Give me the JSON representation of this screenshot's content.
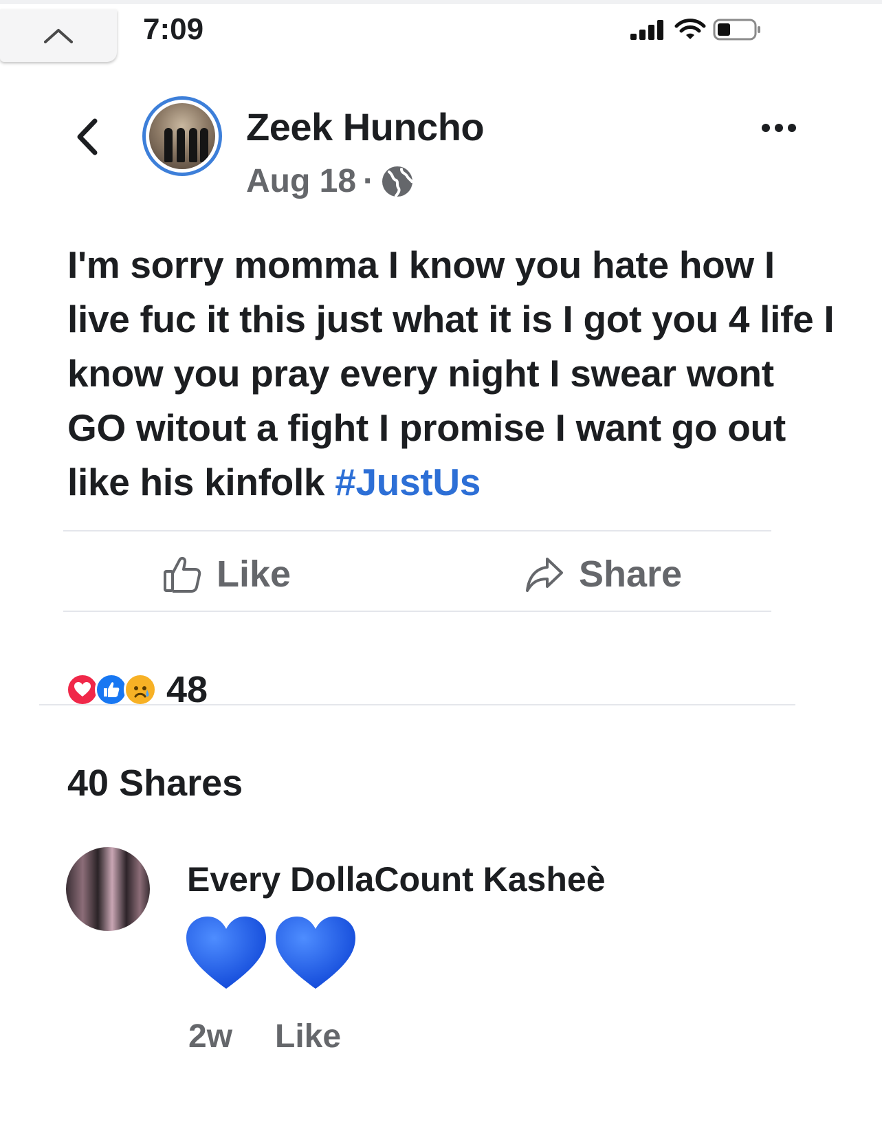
{
  "status_bar": {
    "time": "7:09"
  },
  "post": {
    "author": "Zeek Huncho",
    "date": "Aug 18",
    "separator": "·",
    "text_before_hashtag": "I'm sorry momma I know you hate how I live fuc it this just what it is I got you 4 life I know you pray every night I swear wont GO witout a fight I promise I want go out like his kinfolk ",
    "hashtag": "#JustUs"
  },
  "actions": {
    "like_label": "Like",
    "share_label": "Share"
  },
  "stats": {
    "reaction_count": "48",
    "shares_label": "40 Shares"
  },
  "comment": {
    "author": "Every DollaCount Kasheè",
    "time": "2w",
    "like_label": "Like"
  },
  "colors": {
    "link_blue": "#2d6fd6",
    "secondary_text": "#65676b",
    "avatar_ring": "#3d7fd9"
  },
  "icons": [
    "chevron-up-icon",
    "signal-icon",
    "wifi-icon",
    "battery-icon",
    "back-icon",
    "more-icon",
    "globe-icon",
    "thumbs-up-icon",
    "share-arrow-icon",
    "love-reaction-icon",
    "like-reaction-icon",
    "sad-reaction-icon",
    "blue-heart-emoji"
  ]
}
